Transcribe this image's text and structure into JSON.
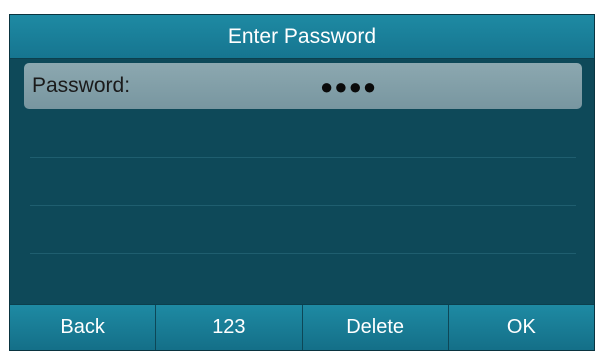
{
  "title": "Enter Password",
  "password_field": {
    "label": "Password:",
    "masked_value": "●●●●"
  },
  "softkeys": [
    "Back",
    "123",
    "Delete",
    "OK"
  ],
  "colors": {
    "title_bar": "#1e8aa3",
    "background": "#0f4a5a",
    "selected_row": "#8ca8b0",
    "softkey_bar": "#1e8aa3",
    "text_light": "#ffffff",
    "text_dark": "#1a1a1a"
  }
}
